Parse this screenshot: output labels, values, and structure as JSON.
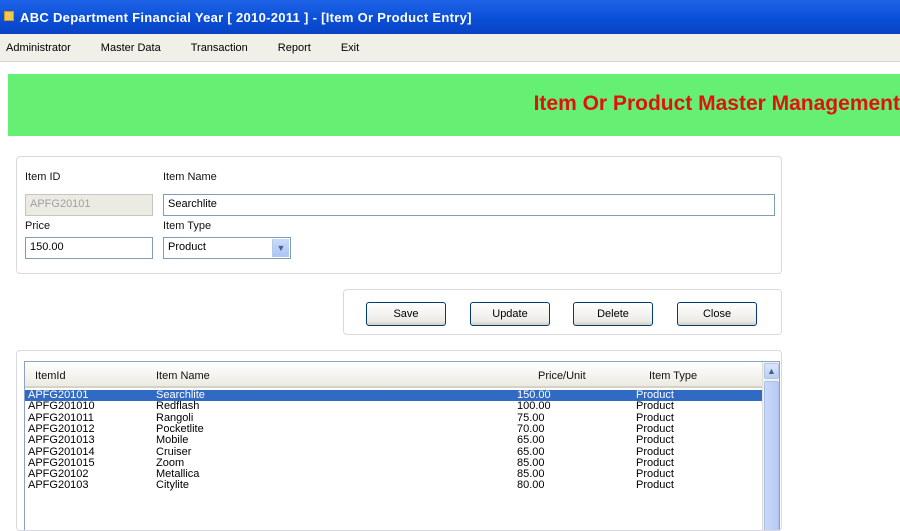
{
  "window": {
    "title": "ABC Department Financial Year [ 2010-2011 ] - [Item Or Product Entry]"
  },
  "menu": {
    "items": [
      "Administrator",
      "Master Data",
      "Transaction",
      "Report",
      "Exit"
    ]
  },
  "banner": {
    "title": "Item Or Product Master Management"
  },
  "form": {
    "item_id_label": "Item ID",
    "item_id_value": "APFG20101",
    "item_name_label": "Item Name",
    "item_name_value": "Searchlite",
    "price_label": "Price",
    "price_value": "150.00",
    "item_type_label": "Item Type",
    "item_type_value": "Product"
  },
  "buttons": {
    "save": "Save",
    "update": "Update",
    "delete": "Delete",
    "close": "Close"
  },
  "grid": {
    "columns": [
      "ItemId",
      "Item Name",
      "Price/Unit",
      "Item Type"
    ],
    "rows": [
      [
        "APFG20101",
        "Searchlite",
        "150.00",
        "Product"
      ],
      [
        "APFG201010",
        "Redflash",
        "100.00",
        "Product"
      ],
      [
        "APFG201011",
        "Rangoli",
        "75.00",
        "Product"
      ],
      [
        "APFG201012",
        "Pocketlite",
        "70.00",
        "Product"
      ],
      [
        "APFG201013",
        "Mobile",
        "65.00",
        "Product"
      ],
      [
        "APFG201014",
        "Cruiser",
        "65.00",
        "Product"
      ],
      [
        "APFG201015",
        "Zoom",
        "85.00",
        "Product"
      ],
      [
        "APFG20102",
        "Metallica",
        "85.00",
        "Product"
      ],
      [
        "APFG20103",
        "Citylite",
        "80.00",
        "Product"
      ]
    ],
    "selected_row": 0
  },
  "colors": {
    "title_bar": "#0a4fd8",
    "banner_bg": "#66f073",
    "banner_text": "#e0120f",
    "selection": "#316ac5"
  }
}
